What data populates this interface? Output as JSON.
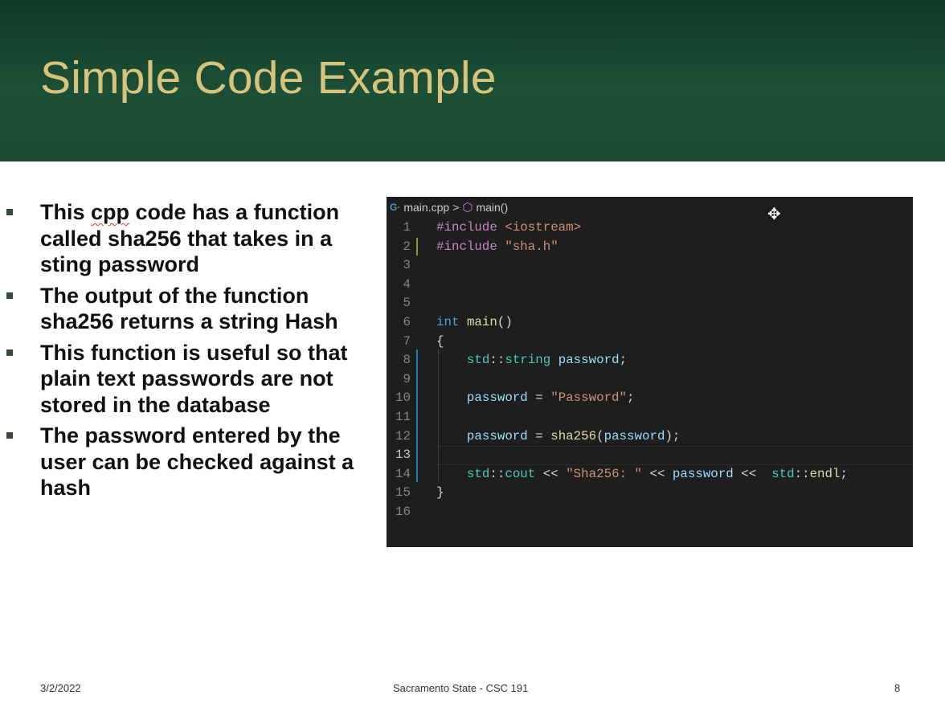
{
  "slide": {
    "title": "Simple Code Example",
    "bullets": [
      {
        "before": "This ",
        "misspelled": "cpp",
        "after": " code has a function called sha256 that takes in a sting password"
      },
      {
        "before": "The output of the function sha256 returns a string Hash",
        "misspelled": "",
        "after": ""
      },
      {
        "before": "This function is useful so that plain text passwords are not stored in the database",
        "misspelled": "",
        "after": ""
      },
      {
        "before": "The password entered by the user can be checked against a hash",
        "misspelled": "",
        "after": ""
      }
    ]
  },
  "editor": {
    "breadcrumb": {
      "file": "main.cpp",
      "separator": ">",
      "symbol": "main()",
      "file_icon": "c-plus-plus-icon",
      "symbol_icon": "cube-icon"
    },
    "colors": {
      "background": "#1e1e1e",
      "keyword": "#569cd6",
      "preprocessor": "#c586c0",
      "string": "#ce9178",
      "function": "#dcdcaa",
      "type": "#4ec9b0",
      "variable": "#9cdcfe",
      "plain": "#d4d4d4"
    },
    "current_line": 13,
    "lines": [
      {
        "n": "1",
        "tokens": [
          [
            "#include",
            "preprocessor"
          ],
          [
            " ",
            "plain"
          ],
          [
            "<iostream>",
            "string"
          ]
        ]
      },
      {
        "n": "2",
        "tokens": [
          [
            "#include",
            "preprocessor"
          ],
          [
            " ",
            "plain"
          ],
          [
            "\"sha.h\"",
            "string"
          ]
        ]
      },
      {
        "n": "3",
        "tokens": []
      },
      {
        "n": "4",
        "tokens": []
      },
      {
        "n": "5",
        "tokens": []
      },
      {
        "n": "6",
        "tokens": [
          [
            "int",
            "keyword"
          ],
          [
            " ",
            "plain"
          ],
          [
            "main",
            "function"
          ],
          [
            "()",
            "plain"
          ]
        ]
      },
      {
        "n": "7",
        "tokens": [
          [
            "{",
            "plain"
          ]
        ]
      },
      {
        "n": "8",
        "tokens": [
          [
            "    ",
            "plain"
          ],
          [
            "std",
            "type"
          ],
          [
            "::",
            "plain"
          ],
          [
            "string",
            "type"
          ],
          [
            " ",
            "plain"
          ],
          [
            "password",
            "variable"
          ],
          [
            ";",
            "plain"
          ]
        ]
      },
      {
        "n": "9",
        "tokens": []
      },
      {
        "n": "10",
        "tokens": [
          [
            "    ",
            "plain"
          ],
          [
            "password",
            "variable"
          ],
          [
            " = ",
            "plain"
          ],
          [
            "\"Password\"",
            "string"
          ],
          [
            ";",
            "plain"
          ]
        ]
      },
      {
        "n": "11",
        "tokens": []
      },
      {
        "n": "12",
        "tokens": [
          [
            "    ",
            "plain"
          ],
          [
            "password",
            "variable"
          ],
          [
            " = ",
            "plain"
          ],
          [
            "sha256",
            "function"
          ],
          [
            "(",
            "plain"
          ],
          [
            "password",
            "variable"
          ],
          [
            ");",
            "plain"
          ]
        ]
      },
      {
        "n": "13",
        "tokens": []
      },
      {
        "n": "14",
        "tokens": [
          [
            "    ",
            "plain"
          ],
          [
            "std",
            "type"
          ],
          [
            "::",
            "plain"
          ],
          [
            "cout",
            "type"
          ],
          [
            " << ",
            "plain"
          ],
          [
            "\"Sha256: \"",
            "string"
          ],
          [
            " << ",
            "plain"
          ],
          [
            "password",
            "variable"
          ],
          [
            " <<  ",
            "plain"
          ],
          [
            "std",
            "type"
          ],
          [
            "::",
            "plain"
          ],
          [
            "endl",
            "function"
          ],
          [
            ";",
            "plain"
          ]
        ]
      },
      {
        "n": "15",
        "tokens": [
          [
            "}",
            "plain"
          ]
        ]
      },
      {
        "n": "16",
        "tokens": []
      }
    ]
  },
  "footer": {
    "date": "3/2/2022",
    "center": "Sacramento State - CSC 191",
    "page": "8"
  }
}
